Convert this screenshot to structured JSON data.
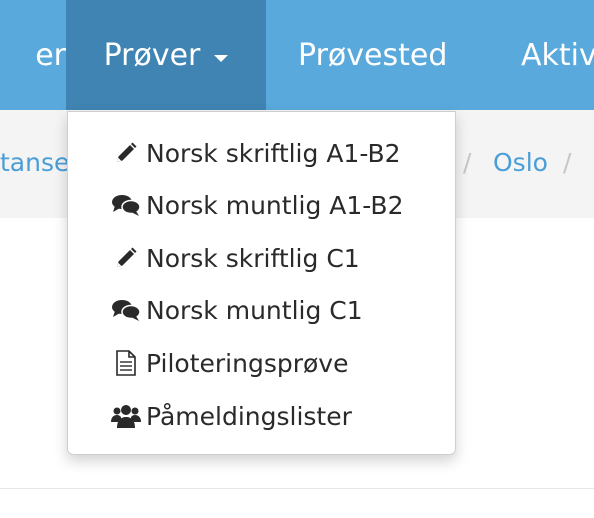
{
  "navbar": {
    "items": [
      {
        "label": "er"
      },
      {
        "label": "Prøver"
      },
      {
        "label": "Prøvested"
      },
      {
        "label": "Aktiv"
      }
    ]
  },
  "breadcrumb": {
    "items": [
      {
        "label": "tanse"
      },
      {
        "label": "Oslo"
      }
    ],
    "separator": "/"
  },
  "dropdown": {
    "items": [
      {
        "label": "Norsk skriftlig A1-B2",
        "icon": "pencil-icon"
      },
      {
        "label": "Norsk muntlig A1-B2",
        "icon": "comments-icon"
      },
      {
        "label": "Norsk skriftlig C1",
        "icon": "pencil-icon"
      },
      {
        "label": "Norsk muntlig C1",
        "icon": "comments-icon"
      },
      {
        "label": "Piloteringsprøve",
        "icon": "document-icon"
      },
      {
        "label": "Påmeldingslister",
        "icon": "users-icon"
      }
    ]
  },
  "colors": {
    "navbar": "#5aa9dc",
    "navbar_active": "#4084b3",
    "breadcrumb_bg": "#f4f4f4",
    "link": "#4a9ed8"
  }
}
